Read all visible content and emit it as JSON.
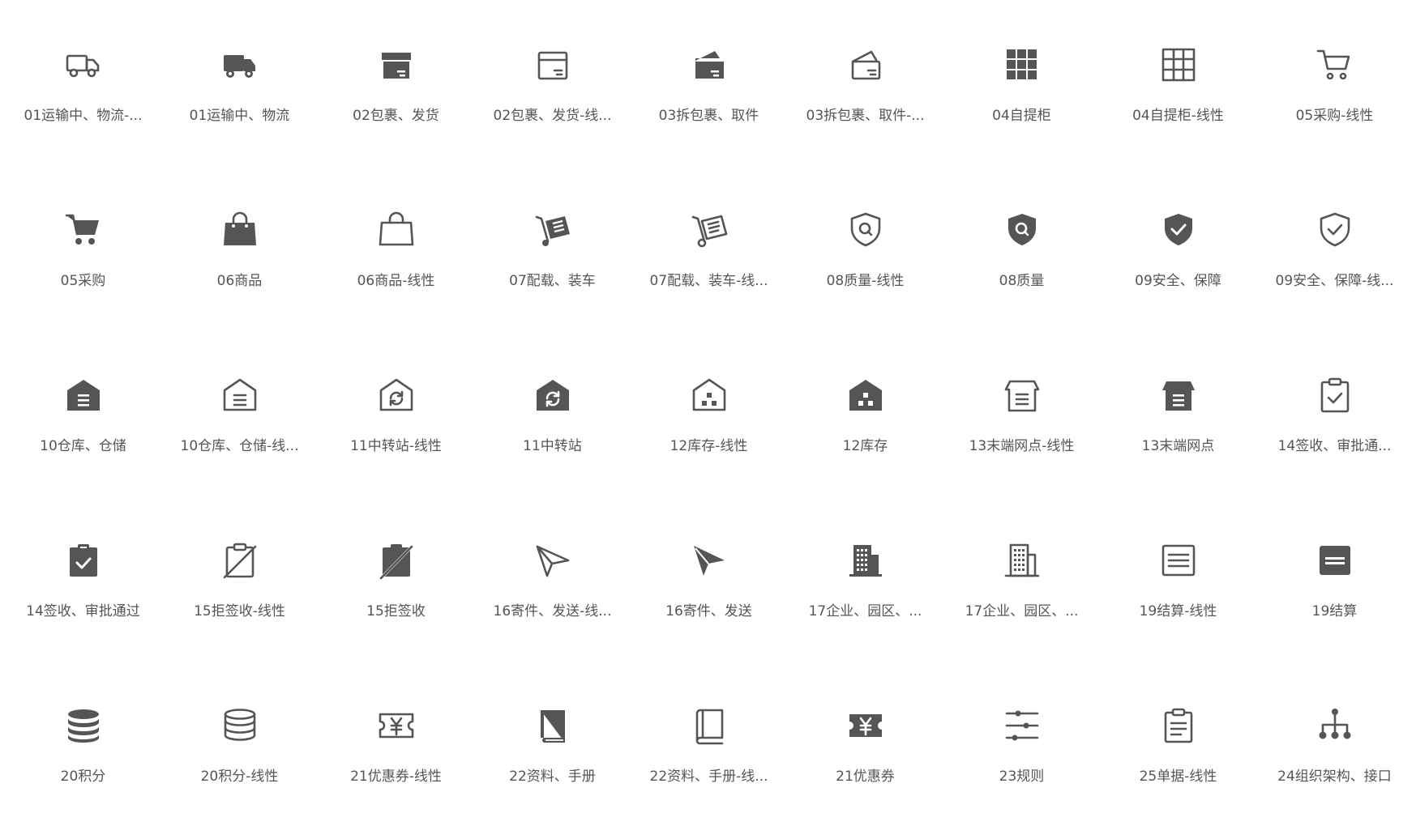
{
  "colors": {
    "icon": "#555555",
    "text": "#555555",
    "background": "#ffffff"
  },
  "items": [
    {
      "label": "01运输中、物流-...",
      "icon": "truck-outline-icon"
    },
    {
      "label": "01运输中、物流",
      "icon": "truck-filled-icon"
    },
    {
      "label": "02包裹、发货",
      "icon": "package-filled-icon"
    },
    {
      "label": "02包裹、发货-线...",
      "icon": "package-outline-icon"
    },
    {
      "label": "03拆包裹、取件",
      "icon": "open-package-filled-icon"
    },
    {
      "label": "03拆包裹、取件-...",
      "icon": "open-package-outline-icon"
    },
    {
      "label": "04自提柜",
      "icon": "locker-filled-icon"
    },
    {
      "label": "04自提柜-线性",
      "icon": "locker-outline-icon"
    },
    {
      "label": "05采购-线性",
      "icon": "cart-outline-icon"
    },
    {
      "label": "05采购",
      "icon": "cart-filled-icon"
    },
    {
      "label": "06商品",
      "icon": "bag-filled-icon"
    },
    {
      "label": "06商品-线性",
      "icon": "bag-outline-icon"
    },
    {
      "label": "07配载、装车",
      "icon": "hand-truck-filled-icon"
    },
    {
      "label": "07配载、装车-线...",
      "icon": "hand-truck-outline-icon"
    },
    {
      "label": "08质量-线性",
      "icon": "quality-shield-outline-icon"
    },
    {
      "label": "08质量",
      "icon": "quality-shield-filled-icon"
    },
    {
      "label": "09安全、保障",
      "icon": "check-shield-filled-icon"
    },
    {
      "label": "09安全、保障-线...",
      "icon": "check-shield-outline-icon"
    },
    {
      "label": "10仓库、仓储",
      "icon": "warehouse-filled-icon"
    },
    {
      "label": "10仓库、仓储-线...",
      "icon": "warehouse-outline-icon"
    },
    {
      "label": "11中转站-线性",
      "icon": "transfer-house-outline-icon"
    },
    {
      "label": "11中转站",
      "icon": "transfer-house-filled-icon"
    },
    {
      "label": "12库存-线性",
      "icon": "stock-house-outline-icon"
    },
    {
      "label": "12库存",
      "icon": "stock-house-filled-icon"
    },
    {
      "label": "13末端网点-线性",
      "icon": "outlet-outline-icon"
    },
    {
      "label": "13末端网点",
      "icon": "outlet-filled-icon"
    },
    {
      "label": "14签收、审批通...",
      "icon": "clipboard-check-outline-icon"
    },
    {
      "label": "14签收、审批通过",
      "icon": "clipboard-check-filled-icon"
    },
    {
      "label": "15拒签收-线性",
      "icon": "clipboard-reject-outline-icon"
    },
    {
      "label": "15拒签收",
      "icon": "clipboard-reject-filled-icon"
    },
    {
      "label": "16寄件、发送-线...",
      "icon": "paper-plane-outline-icon"
    },
    {
      "label": "16寄件、发送",
      "icon": "paper-plane-filled-icon"
    },
    {
      "label": "17企业、园区、...",
      "icon": "building-filled-icon"
    },
    {
      "label": "17企业、园区、...",
      "icon": "building-outline-icon"
    },
    {
      "label": "19结算-线性",
      "icon": "settlement-outline-icon"
    },
    {
      "label": "19结算",
      "icon": "settlement-filled-icon"
    },
    {
      "label": "20积分",
      "icon": "coins-filled-icon"
    },
    {
      "label": "20积分-线性",
      "icon": "coins-outline-icon"
    },
    {
      "label": "21优惠券-线性",
      "icon": "coupon-outline-icon"
    },
    {
      "label": "22资料、手册",
      "icon": "book-filled-icon"
    },
    {
      "label": "22资料、手册-线...",
      "icon": "book-outline-icon"
    },
    {
      "label": "21优惠券",
      "icon": "coupon-filled-icon"
    },
    {
      "label": "23规则",
      "icon": "rules-sliders-icon"
    },
    {
      "label": "25单据-线性",
      "icon": "document-clipboard-outline-icon"
    },
    {
      "label": "24组织架构、接口",
      "icon": "org-chart-icon"
    }
  ]
}
